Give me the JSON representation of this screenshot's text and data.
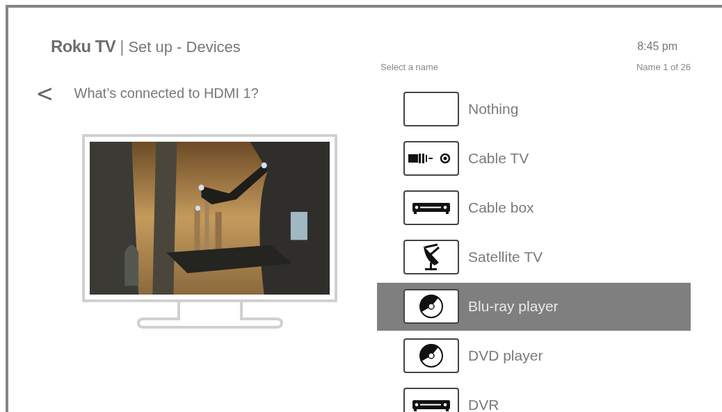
{
  "header": {
    "brand": "Roku TV",
    "separator": "|",
    "title": "Set up - Devices",
    "time": "8:45 pm"
  },
  "question": {
    "back": "<",
    "text": "What’s connected to HDMI 1?"
  },
  "list": {
    "caption": "Select a name",
    "counter": "Name 1 of 26",
    "items": [
      {
        "label": "Nothing",
        "kind": "none",
        "selected": false
      },
      {
        "label": "Cable TV",
        "kind": "cable",
        "selected": false
      },
      {
        "label": "Cable box",
        "kind": "box",
        "selected": false
      },
      {
        "label": "Satellite TV",
        "kind": "satellite",
        "selected": false
      },
      {
        "label": "Blu-ray player",
        "kind": "disc",
        "selected": true
      },
      {
        "label": "DVD player",
        "kind": "disc",
        "selected": false
      },
      {
        "label": "DVR",
        "kind": "box",
        "selected": false
      }
    ]
  }
}
